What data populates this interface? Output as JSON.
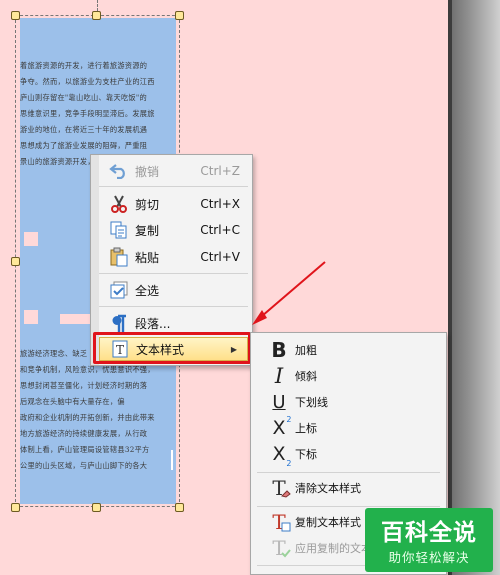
{
  "document": {
    "text_lines": [
      "着旅游资源的开发，进行着旅游资源的",
      "争夺。然而，以旅游业为支柱产业的江西",
      "庐山则存留在\"靠山吃山、靠天吃饭\"的",
      "思维意识里，竞争手段明显滞后。发展旅",
      "游业的地位，在将近三十年的发展机遇",
      "思想成为了旅游业发展的阻碍，严重阻",
      "景山的旅游资源开发，面临着众多",
      "",
      "",
      "",
      "",
      "",
      "",
      "",
      "",
      "",
      "",
      "",
      "旅游经济理念、缺乏",
      "和竞争机制，风险意识，忧患意识不强，",
      "思想封闭甚至僵化，计划经济时期的落",
      "后观念在头脑中有大量存在，偏",
      "政府和企业机制的开拓创新，并由此带来",
      "地方旅游经济的持续健康发展，从行政",
      "体制上看，庐山管理局设管辖县32平方",
      "公里的山头区域，与庐山山脚下的各大"
    ]
  },
  "context_menu": {
    "items": [
      {
        "label": "撤销",
        "shortcut": "Ctrl+Z",
        "icon": "undo-icon",
        "enabled": false
      },
      {
        "label": "剪切",
        "shortcut": "Ctrl+X",
        "icon": "scissors-icon",
        "enabled": true
      },
      {
        "label": "复制",
        "shortcut": "Ctrl+C",
        "icon": "copy-icon",
        "enabled": true
      },
      {
        "label": "粘贴",
        "shortcut": "Ctrl+V",
        "icon": "paste-icon",
        "enabled": true
      },
      {
        "label": "全选",
        "shortcut": "",
        "icon": "select-all-icon",
        "enabled": true
      },
      {
        "label": "段落...",
        "shortcut": "",
        "icon": "paragraph-icon",
        "enabled": true
      },
      {
        "label": "文本样式",
        "shortcut": "",
        "icon": "text-style-icon",
        "enabled": true,
        "has_submenu": true
      }
    ]
  },
  "text_style_submenu": {
    "items": [
      {
        "label": "加粗",
        "icon": "bold-icon",
        "glyph": "B"
      },
      {
        "label": "倾斜",
        "icon": "italic-icon",
        "glyph": "I"
      },
      {
        "label": "下划线",
        "icon": "underline-icon",
        "glyph": "U"
      },
      {
        "label": "上标",
        "icon": "superscript-icon",
        "glyph": "X",
        "mark": "2"
      },
      {
        "label": "下标",
        "icon": "subscript-icon",
        "glyph": "X",
        "mark": "2"
      },
      {
        "label": "清除文本样式",
        "icon": "clear-style-icon",
        "glyph": "T"
      },
      {
        "label": "复制文本样式",
        "icon": "copy-style-icon",
        "glyph": "T"
      },
      {
        "label": "应用复制的文本",
        "icon": "apply-style-icon",
        "glyph": "T",
        "enabled": false
      }
    ]
  },
  "watermark": {
    "title": "百科全说",
    "subtitle": "助你轻松解决"
  },
  "colors": {
    "highlight_box": "#e0141b",
    "annotation_arrow": "#e0141b",
    "watermark_green": "#22b14c",
    "selection_blue": "#9cc0ea"
  }
}
